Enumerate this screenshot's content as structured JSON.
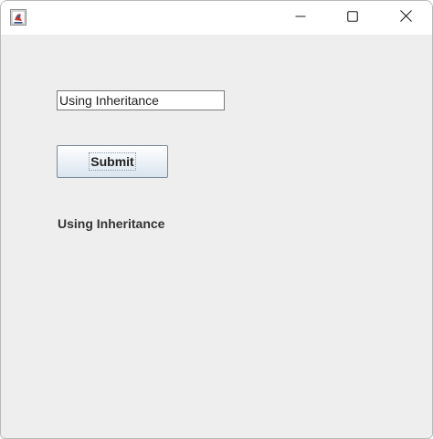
{
  "window": {
    "controls": {
      "minimize_icon": "minimize-icon",
      "maximize_icon": "maximize-icon",
      "close_icon": "close-icon"
    },
    "app_icon": "java-app-icon"
  },
  "form": {
    "input_value": "Using Inheritance",
    "submit_label": "Submit",
    "result_text": "Using Inheritance"
  },
  "colors": {
    "content_background": "#eeeeee",
    "titlebar_background": "#ffffff",
    "button_border": "#7a8a99"
  }
}
